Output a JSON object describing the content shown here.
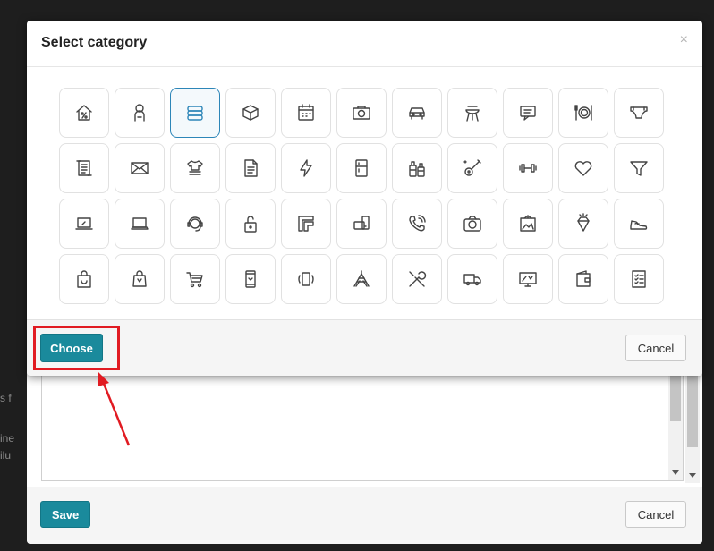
{
  "colors": {
    "accent": "#1a8a9c",
    "selected_border": "#2d86b8",
    "annotation_red": "#e11b22"
  },
  "dialog": {
    "title": "Select category",
    "close_glyph": "×",
    "choose_label": "Choose",
    "cancel_label": "Cancel",
    "selected_index": 2,
    "icons": [
      "house-percent-icon",
      "baby-icon",
      "towels-icon",
      "box-icon",
      "calendar-icon",
      "camera-icon",
      "car-icon",
      "grill-icon",
      "chat-icon",
      "dinner-plate-icon",
      "diaper-icon",
      "scroll-icon",
      "envelope-icon",
      "clothes-icon",
      "document-icon",
      "lightning-icon",
      "fridge-icon",
      "bottles-icon",
      "guitar-icon",
      "dumbbell-icon",
      "heart-icon",
      "funnel-icon",
      "laptop-speed-icon",
      "laptop-icon",
      "headset-agent-icon",
      "unlock-icon",
      "frames-icon",
      "wallet-phone-icon",
      "phone-call-icon",
      "photo-camera-icon",
      "picture-icon",
      "diamond-icon",
      "sneaker-icon",
      "shopping-bag-icon",
      "gift-bag-icon",
      "shopping-cart-icon",
      "smartphone-icon",
      "phone-vibrate-icon",
      "amusement-ride-icon",
      "tools-icon",
      "delivery-truck-icon",
      "tv-icon",
      "wallet-icon",
      "checklist-icon"
    ]
  },
  "background_form": {
    "save_label": "Save",
    "cancel_label": "Cancel",
    "edge_text_1": "s f",
    "edge_text_2": "ine",
    "edge_text_3": "ilu"
  }
}
